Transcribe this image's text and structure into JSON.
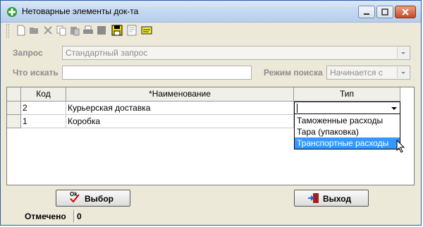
{
  "window": {
    "title": "Нетоварные элементы док-та"
  },
  "toolbar": {
    "icons": [
      "new-doc-icon",
      "open-folder-icon",
      "delete-icon",
      "copy-icon",
      "paste-icon",
      "print-icon",
      "stop-icon",
      "save-icon",
      "preview-icon",
      "notes-icon"
    ]
  },
  "query": {
    "label": "Запрос",
    "value": "Стандартный запрос"
  },
  "search": {
    "label": "Что искать",
    "value": ""
  },
  "search_mode": {
    "label": "Режим поиска",
    "value": "Начинается с"
  },
  "table": {
    "headers": {
      "code": "Код",
      "name": "*Наименование",
      "type": "Тип"
    },
    "rows": [
      {
        "code": "2",
        "name": "Курьерская доставка",
        "type": ""
      },
      {
        "code": "1",
        "name": "Коробка",
        "type": ""
      }
    ]
  },
  "type_dropdown": {
    "options": [
      "Таможенные расходы",
      "Тара (упаковка)",
      "Транспортные расходы"
    ],
    "highlighted": "Транспортные расходы"
  },
  "buttons": {
    "select": "Выбор",
    "select_icon_text": "Ok",
    "exit": "Выход"
  },
  "status": {
    "label": "Отмечено",
    "value": "0"
  }
}
